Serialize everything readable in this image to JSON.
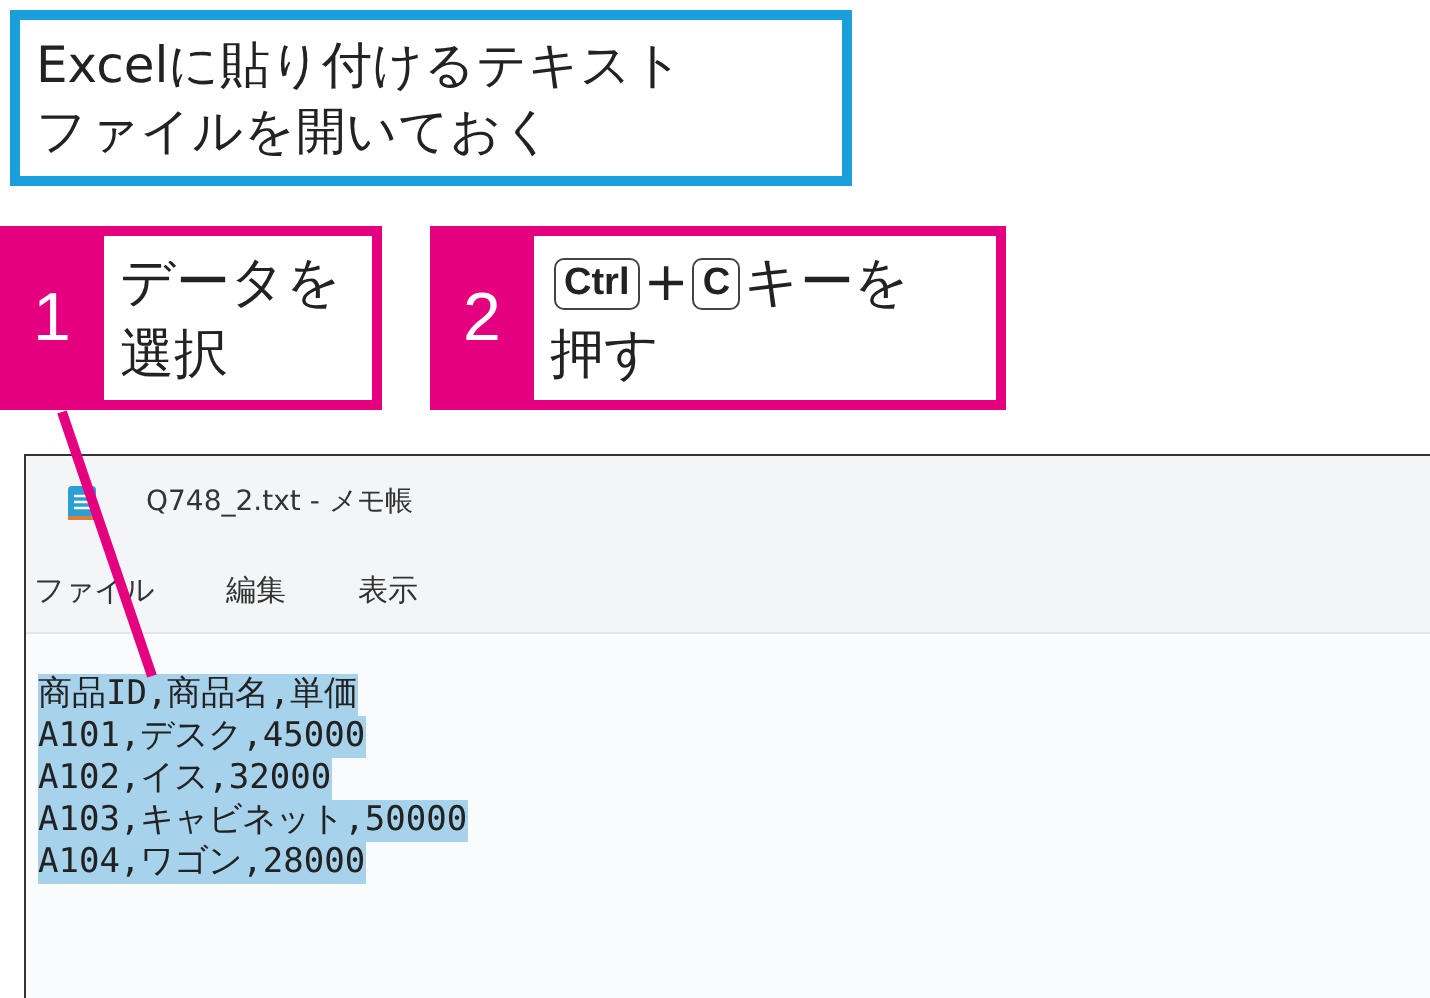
{
  "caption": {
    "lines": [
      "Excelに貼り付けるテキスト",
      "ファイルを開いておく"
    ]
  },
  "steps": [
    {
      "number": "1",
      "lines": [
        [
          {
            "kind": "text",
            "text": "データを"
          }
        ],
        [
          {
            "kind": "text",
            "text": "選択"
          }
        ]
      ]
    },
    {
      "number": "2",
      "lines": [
        [
          {
            "kind": "key",
            "text": "Ctrl"
          },
          {
            "kind": "text",
            "text": "+"
          },
          {
            "kind": "key",
            "text": "C"
          },
          {
            "kind": "text",
            "text": "キーを"
          }
        ],
        [
          {
            "kind": "text",
            "text": "押す"
          }
        ]
      ]
    }
  ],
  "window": {
    "title": "Q748_2.txt - メモ帳"
  },
  "menu": [
    "ファイル",
    "編集",
    "表示"
  ],
  "editor": {
    "lines": [
      {
        "text": "商品ID,商品名,単価",
        "selected": true
      },
      {
        "text": "A101,デスク,45000",
        "selected": true
      },
      {
        "text": "A102,イス,32000",
        "selected": true
      },
      {
        "text": "A103,キャビネット,50000",
        "selected": true
      },
      {
        "text": "A104,ワゴン,28000",
        "selected": true
      }
    ]
  }
}
